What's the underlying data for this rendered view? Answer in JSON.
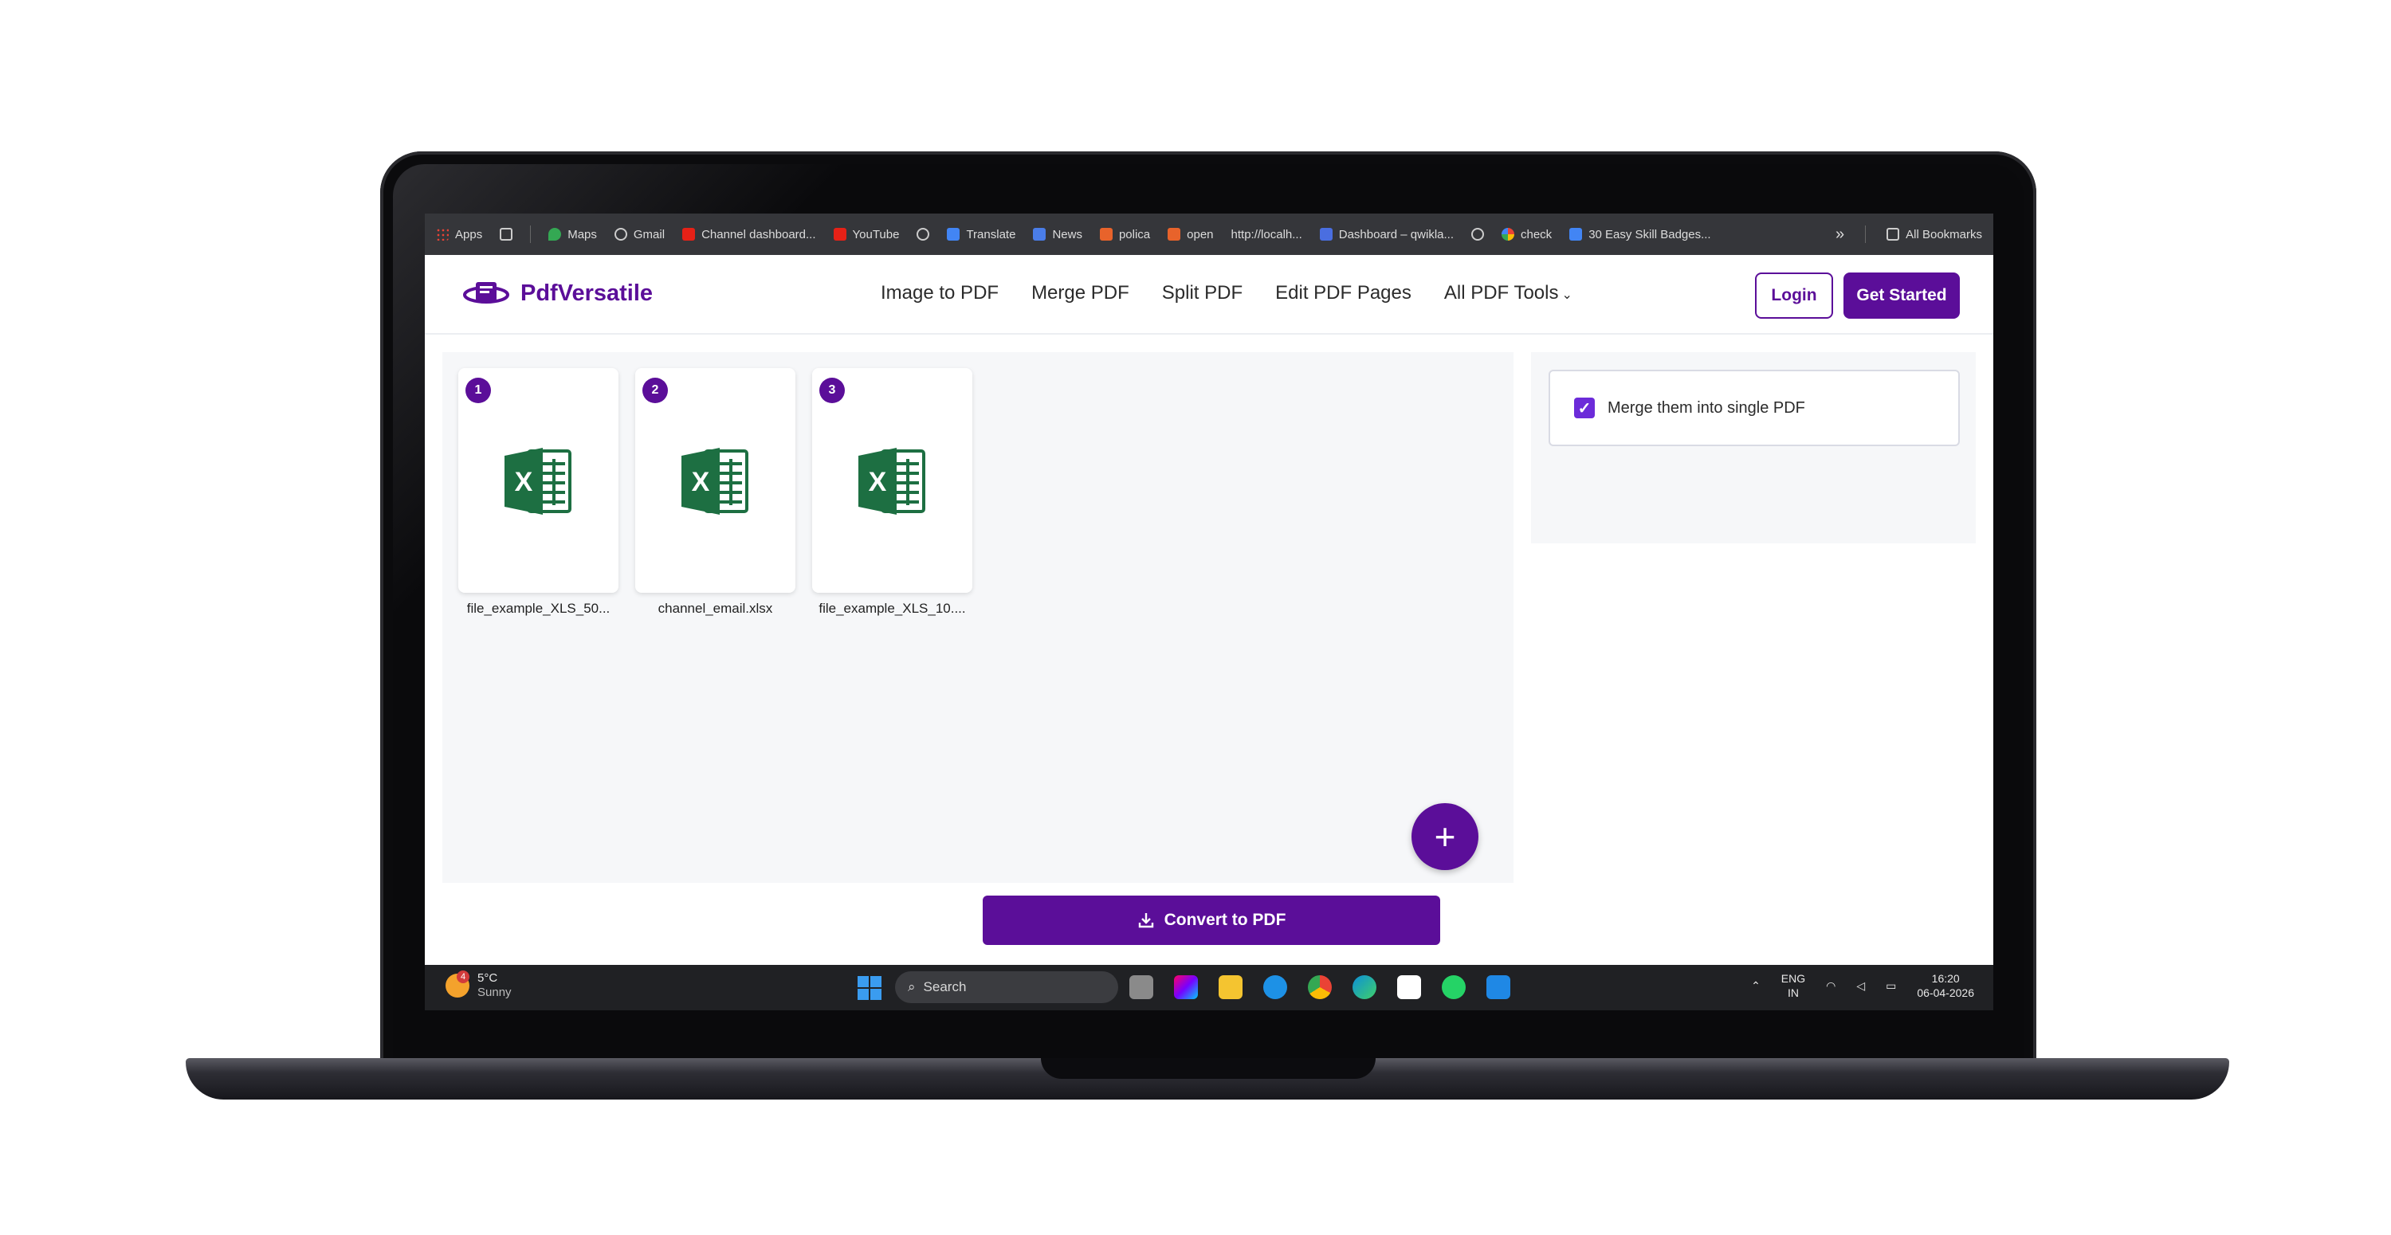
{
  "bookmarks": {
    "items": [
      "Apps",
      "Maps",
      "Gmail",
      "Channel dashboard...",
      "YouTube",
      "Translate",
      "News",
      "polica",
      "open",
      "http://localh...",
      "Dashboard – qwikla...",
      "check",
      "30 Easy Skill Badges..."
    ],
    "overflow": "»",
    "all_bookmarks": "All Bookmarks"
  },
  "header": {
    "brand": "PdfVersatile",
    "nav": [
      "Image to PDF",
      "Merge PDF",
      "Split PDF",
      "Edit PDF Pages",
      "All PDF Tools"
    ],
    "login": "Login",
    "get_started": "Get Started"
  },
  "files": [
    {
      "index": "1",
      "name": "file_example_XLS_50..."
    },
    {
      "index": "2",
      "name": "channel_email.xlsx"
    },
    {
      "index": "3",
      "name": "file_example_XLS_10...."
    }
  ],
  "add_button": "+",
  "options": {
    "merge_label": "Merge them into single PDF",
    "merge_checked": true
  },
  "convert_button": "Convert to PDF",
  "taskbar": {
    "temperature": "5°C",
    "condition": "Sunny",
    "weather_badge": "4",
    "search": "Search",
    "language": "ENG",
    "region": "IN",
    "time": "16:20",
    "date": "06-04-2026"
  },
  "colors": {
    "brand": "#5b0e99",
    "checkbox": "#6c2bd9",
    "excel_green": "#1d6f42"
  }
}
